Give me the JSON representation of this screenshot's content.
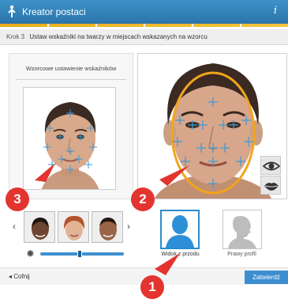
{
  "app": {
    "title": "Kreator postaci",
    "info_symbol": "i"
  },
  "step": {
    "number": "Krok 3",
    "instruction": "Ustaw wskaźniki na twarzy w miejscach wskazanych na wzorcu"
  },
  "left_panel": {
    "title": "Wzorcowe ustawienie wskaźników"
  },
  "thumbnails": {
    "prev_arrow": "‹",
    "next_arrow": "›",
    "count": 3
  },
  "slider": {
    "value_fraction": 0.47
  },
  "views": {
    "front_label": "Widok z przodu",
    "profile_label": "Prawy profil"
  },
  "footer": {
    "back_arrow": "◂",
    "back_label": "Cofnij",
    "confirm_label": "Zatwierdź"
  },
  "markers": {
    "one": "1",
    "two": "2",
    "three": "3"
  },
  "icons": {
    "title_icon": "person-upload-icon",
    "eye_icon": "eye-icon",
    "lips_icon": "lips-icon",
    "brightness_icon": "sun-icon"
  },
  "colors": {
    "accent": "#2f80c0",
    "step_bar": "#f0b82c",
    "marker": "#e3342f",
    "guide_oval": "#f2a51c"
  }
}
